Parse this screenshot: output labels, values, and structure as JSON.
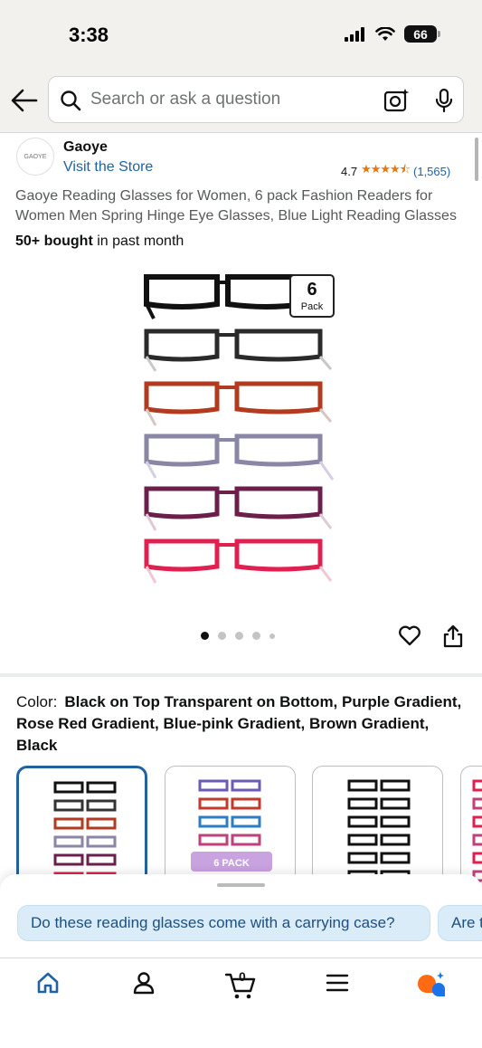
{
  "status_bar": {
    "time": "3:38",
    "battery": "66"
  },
  "search": {
    "placeholder": "Search or ask a question"
  },
  "brand": {
    "logo_text": "GAOYE",
    "name": "Gaoye",
    "store_link": "Visit the Store"
  },
  "rating": {
    "value": "4.7",
    "stars": 4.5,
    "count": "(1,565)"
  },
  "product": {
    "title": "Gaoye Reading Glasses for Women, 6 pack Fashion Readers for Women Men Spring Hinge Eye Glasses, Blue Light Reading Glasses",
    "bought_bold": "50+ bought",
    "bought_rest": " in past month",
    "badge_number": "6",
    "badge_label": "Pack",
    "frame_colors": [
      "#111111",
      "#2a2a2a",
      "#b23a1e",
      "#8a86a6",
      "#6b1f4a",
      "#e0204f"
    ]
  },
  "carousel": {
    "total": 5,
    "active": 0
  },
  "color": {
    "label": "Color:",
    "value": "Black on Top Transparent on Bottom, Purple Gradient, Rose Red Gradient, Blue-pink Gradient, Brown Gradient, Black"
  },
  "swatches": [
    {
      "name": "gradient-mix",
      "selected": true
    },
    {
      "name": "six-pack-colorful",
      "badge": "6 PACK",
      "selected": false
    },
    {
      "name": "all-black",
      "selected": false
    },
    {
      "name": "red-partial",
      "selected": false
    }
  ],
  "questions": [
    "Do these reading glasses come with a carrying case?",
    "Are t"
  ],
  "tab_bar": {
    "cart_count": "0"
  },
  "colors": {
    "link": "#2162a1",
    "star": "#e47911",
    "chip_bg": "#d9ecf8",
    "home_active": "#2162a1"
  }
}
